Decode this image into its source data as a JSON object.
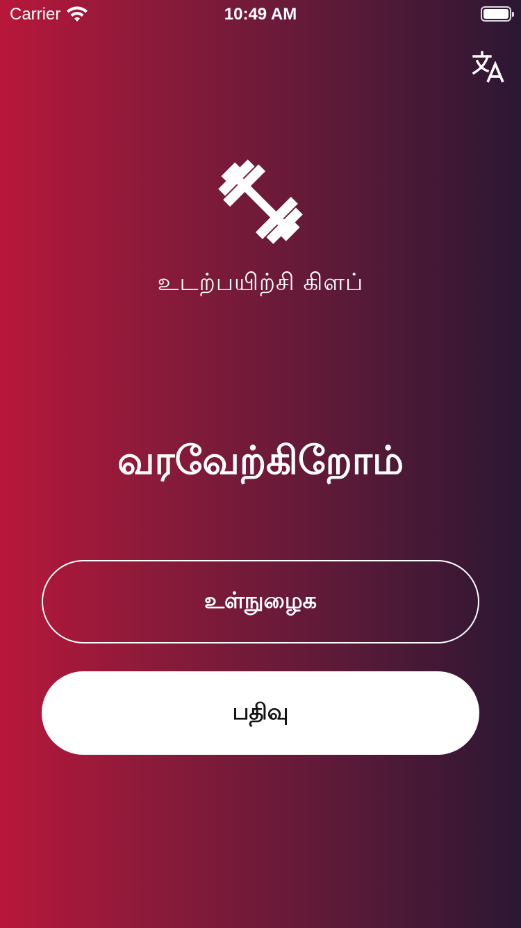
{
  "status_bar": {
    "carrier": "Carrier",
    "time": "10:49 AM"
  },
  "header": {
    "translate_icon": "translate-icon"
  },
  "logo": {
    "icon": "dumbbell-icon",
    "club_name": "உடற்பயிற்சி கிளப்"
  },
  "main": {
    "welcome": "வரவேற்கிறோம்",
    "login_label": "உள்நுழைக",
    "register_label": "பதிவு"
  },
  "colors": {
    "gradient_start": "#b8173a",
    "gradient_end": "#2c1733",
    "button_fill": "#ffffff"
  }
}
